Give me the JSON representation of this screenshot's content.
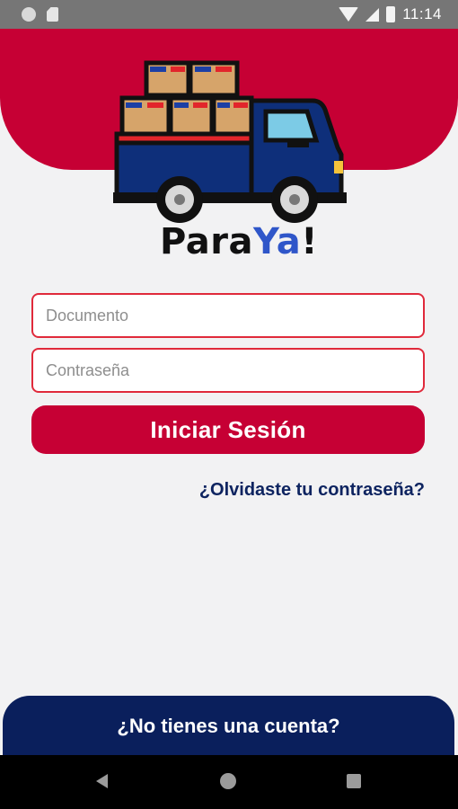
{
  "status_bar": {
    "time": "11:14",
    "icons": [
      "notification-circle-icon",
      "sd-card-icon",
      "wifi-icon",
      "signal-icon",
      "battery-icon"
    ]
  },
  "brand": {
    "name_part1": "Para",
    "name_part2": "Ya",
    "name_part3": "!",
    "logo_icon": "delivery-truck-icon"
  },
  "login_form": {
    "document_placeholder": "Documento",
    "password_placeholder": "Contraseña",
    "login_button": "Iniciar Sesión",
    "forgot_link": "¿Olvidaste tu contraseña?"
  },
  "footer": {
    "signup_prompt": "¿No tienes una cuenta?"
  },
  "navigation": {
    "icons": [
      "back-icon",
      "home-icon",
      "recent-apps-icon"
    ]
  },
  "colors": {
    "primary_red": "#c60034",
    "navy": "#0a1f5c",
    "field_border": "#e02a3b",
    "background": "#f2f2f3"
  }
}
